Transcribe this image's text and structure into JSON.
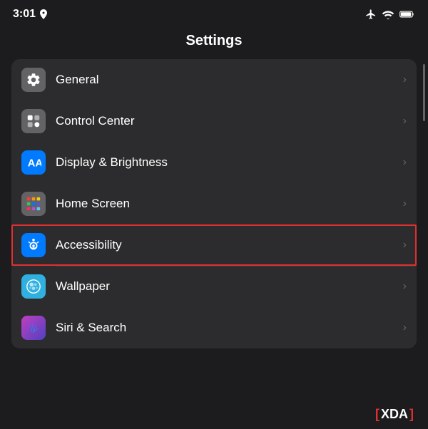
{
  "statusBar": {
    "time": "3:01",
    "locationIcon": "navigation-icon"
  },
  "header": {
    "title": "Settings"
  },
  "settingsItems": [
    {
      "id": "general",
      "label": "General",
      "iconType": "general",
      "highlighted": false
    },
    {
      "id": "control-center",
      "label": "Control Center",
      "iconType": "control",
      "highlighted": false
    },
    {
      "id": "display-brightness",
      "label": "Display & Brightness",
      "iconType": "display",
      "highlighted": false
    },
    {
      "id": "home-screen",
      "label": "Home Screen",
      "iconType": "homescreen",
      "highlighted": false
    },
    {
      "id": "accessibility",
      "label": "Accessibility",
      "iconType": "accessibility",
      "highlighted": true
    },
    {
      "id": "wallpaper",
      "label": "Wallpaper",
      "iconType": "wallpaper",
      "highlighted": false
    },
    {
      "id": "siri-search",
      "label": "Siri & Search",
      "iconType": "siri",
      "highlighted": false
    }
  ],
  "chevron": "›",
  "watermark": {
    "bracket_open": "[",
    "text": "XDA",
    "bracket_close": "]"
  }
}
